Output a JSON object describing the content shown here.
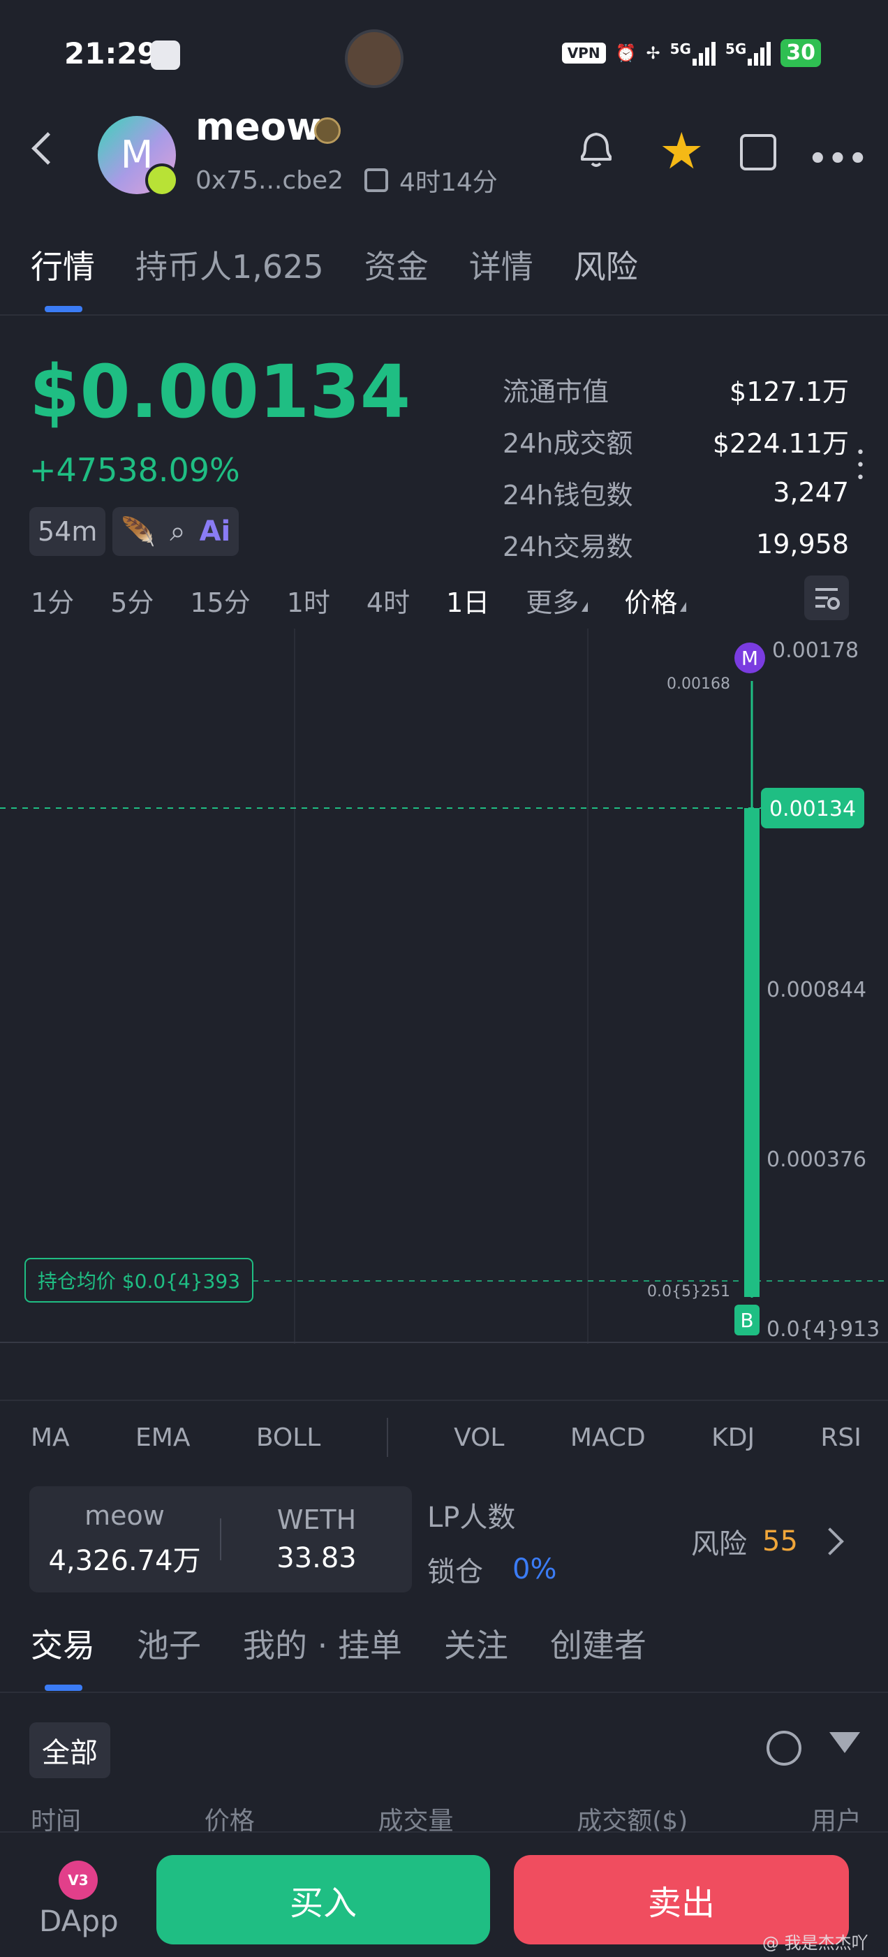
{
  "status_bar": {
    "time": "21:29",
    "vpn": "VPN",
    "network_1": "5G",
    "network_2": "5G",
    "battery": "30"
  },
  "header": {
    "avatar_letter": "M",
    "token_name": "meow",
    "address": "0x75...cbe2",
    "age": "4时14分"
  },
  "tabs": [
    "行情",
    "持币人1,625",
    "资金",
    "详情",
    "风险"
  ],
  "price": {
    "value": "$0.00134",
    "change": "+47538.09%"
  },
  "chips": {
    "interval": "54m"
  },
  "stats": [
    {
      "label": "流通市值",
      "value": "$127.1万"
    },
    {
      "label": "24h成交额",
      "value": "$224.11万"
    },
    {
      "label": "24h钱包数",
      "value": "3,247"
    },
    {
      "label": "24h交易数",
      "value": "19,958"
    }
  ],
  "timeframes": [
    "1分",
    "5分",
    "15分",
    "1时",
    "4时",
    "1日",
    "更多",
    "价格"
  ],
  "chart": {
    "y_labels": [
      "0.00178",
      "0.00134",
      "0.000844",
      "0.000376",
      "0.0{4}913"
    ],
    "high_label": "0.00168",
    "low_label": "0.0{5}251",
    "current_price_tag": "0.00134",
    "avg_cost_tag": "持仓均价 $0.0{4}393",
    "marker_top": "M",
    "marker_bottom": "B"
  },
  "indicators": [
    "MA",
    "EMA",
    "BOLL",
    "VOL",
    "MACD",
    "KDJ",
    "RSI"
  ],
  "liquidity": {
    "token_name": "meow",
    "token_amount": "4,326.74万",
    "quote_name": "WETH",
    "quote_amount": "33.83",
    "lp_holders_label": "LP人数",
    "lock_label": "锁仓",
    "lock_pct": "0%",
    "risk_label": "风险",
    "risk_score": "55"
  },
  "trade_tabs": [
    "交易",
    "池子",
    "我的 · 挂单",
    "关注",
    "创建者"
  ],
  "filter_all": "全部",
  "column_heads": [
    "时间",
    "价格",
    "成交量",
    "成交额($)",
    "用户"
  ],
  "bottom": {
    "dapp_badge": "V3",
    "dapp_label": "DApp",
    "buy": "买入",
    "sell": "卖出"
  },
  "watermark": "@ 我是杰杰吖",
  "colors": {
    "background": "#1f222b",
    "up_green": "#1fbe83",
    "down_red": "#f04d5f",
    "accent_blue": "#3b7cf5",
    "star_gold": "#f5b916",
    "risk_orange": "#f0a63a"
  }
}
